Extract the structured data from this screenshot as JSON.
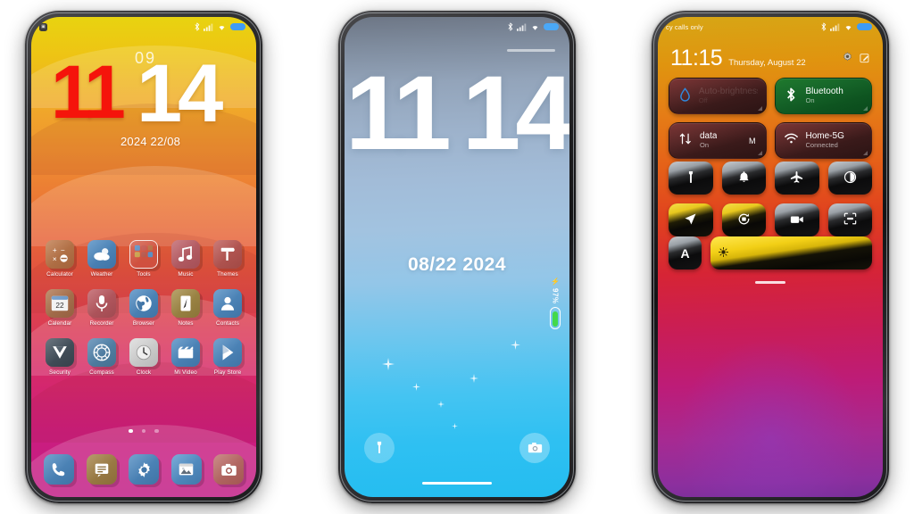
{
  "phone1": {
    "name": "home-screen",
    "statusbar": {
      "notification_badge": "app",
      "icons": [
        "bluetooth-icon",
        "signal-icon",
        "wifi-icon",
        "battery-icon"
      ]
    },
    "clock_widget": {
      "hours": "11",
      "minutes": "14",
      "seconds": "09",
      "date": "2024 22/08",
      "hours_color": "#f5140b",
      "minutes_color": "#ffffff"
    },
    "apps": [
      [
        {
          "label": "Calculator",
          "icon": "calculator-icon",
          "color": "#b5734a",
          "glyph": "÷"
        },
        {
          "label": "Weather",
          "icon": "weather-icon",
          "color": "#4a82b5",
          "glyph": "☁"
        },
        {
          "label": "Tools",
          "icon": "tools-folder-icon",
          "color": "#c0564f",
          "glyph": "••"
        },
        {
          "label": "Music",
          "icon": "music-icon",
          "color": "#b5565e",
          "glyph": "♫"
        },
        {
          "label": "Themes",
          "icon": "themes-icon",
          "color": "#b5504f",
          "glyph": "⛏"
        }
      ],
      [
        {
          "label": "Calendar",
          "icon": "calendar-icon",
          "color": "#a8714c",
          "glyph": "22"
        },
        {
          "label": "Recorder",
          "icon": "recorder-icon",
          "color": "#b5545a",
          "glyph": "Ἲ4"
        },
        {
          "label": "Browser",
          "icon": "browser-icon",
          "color": "#4a86bb",
          "glyph": "ἰd"
        },
        {
          "label": "Notes",
          "icon": "notes-icon",
          "color": "#9c8442",
          "glyph": "✎"
        },
        {
          "label": "Contacts",
          "icon": "contacts-icon",
          "color": "#4a86bb",
          "glyph": "὆4"
        }
      ],
      [
        {
          "label": "Security",
          "icon": "security-icon",
          "color": "#3f4b55",
          "glyph": "▼"
        },
        {
          "label": "Compass",
          "icon": "compass-icon",
          "color": "#4f7fa8",
          "glyph": "✲"
        },
        {
          "label": "Clock",
          "icon": "clock-icon",
          "color": "#c6c6c6",
          "glyph": "ὕ1"
        },
        {
          "label": "Mi Video",
          "icon": "mi-video-icon",
          "color": "#4a86bb",
          "glyph": "Ἲc"
        },
        {
          "label": "Play Store",
          "icon": "play-store-icon",
          "color": "#4a86bb",
          "glyph": "▶"
        }
      ]
    ],
    "page_dots": {
      "count": 3,
      "active_index": 0
    },
    "dock": [
      {
        "label": "Phone",
        "icon": "phone-icon",
        "color": "#4a86bb",
        "glyph": "Ὅe"
      },
      {
        "label": "Messages",
        "icon": "messages-icon",
        "color": "#9c7a47",
        "glyph": "Ὂc"
      },
      {
        "label": "Settings",
        "icon": "settings-icon",
        "color": "#4a86bb",
        "glyph": "⚙"
      },
      {
        "label": "Gallery",
        "icon": "gallery-icon",
        "color": "#4f8ec4",
        "glyph": "Ὓc"
      },
      {
        "label": "Camera",
        "icon": "camera-icon",
        "color": "#b5645e",
        "glyph": "὏7"
      }
    ]
  },
  "phone2": {
    "name": "lock-screen",
    "statusbar": {
      "icons": [
        "bluetooth-icon",
        "signal-icon",
        "wifi-icon",
        "battery-icon"
      ]
    },
    "clock": {
      "hours": "11",
      "minutes": "14",
      "date": "08/22 2024"
    },
    "battery": {
      "percent": "97%",
      "charging": true,
      "charging_glyph": "⚡"
    },
    "shortcuts": {
      "left": {
        "label": "Flashlight",
        "icon": "flashlight-icon"
      },
      "right": {
        "label": "Camera",
        "icon": "camera-icon"
      }
    }
  },
  "phone3": {
    "name": "control-center",
    "statusbar": {
      "carrier": "cy calls only",
      "icons": [
        "bluetooth-icon",
        "signal-icon",
        "wifi-icon",
        "battery-icon"
      ]
    },
    "header": {
      "time": "11:15",
      "date": "Thursday, August 22",
      "settings_icon": "gear-icon",
      "edit_icon": "edit-icon"
    },
    "big_tiles": [
      {
        "title": "Auto-brightness",
        "subtitle": "Off",
        "icon": "water-drop-icon",
        "state": "off",
        "dim": true
      },
      {
        "title": "Bluetooth",
        "subtitle": "On",
        "icon": "bluetooth-icon",
        "state": "on",
        "dim": false
      },
      {
        "title": "data",
        "subtitle": "On",
        "extra": "M",
        "icon": "mobile-data-icon",
        "state": "off",
        "dim": false
      },
      {
        "title": "Home-5G",
        "subtitle": "Connected",
        "icon": "wifi-icon",
        "state": "off",
        "dim": false
      }
    ],
    "quick_tiles": [
      {
        "label": "Flashlight",
        "icon": "flashlight-icon",
        "glyph": "ὒ6",
        "active": false
      },
      {
        "label": "Ring",
        "icon": "bell-icon",
        "glyph": "ὑ4",
        "active": false
      },
      {
        "label": "Airplane mode",
        "icon": "airplane-icon",
        "glyph": "✈",
        "active": false
      },
      {
        "label": "Dark mode",
        "icon": "dark-mode-icon",
        "glyph": "◐",
        "active": false
      },
      {
        "label": "Location",
        "icon": "location-icon",
        "glyph": "➤",
        "active": true
      },
      {
        "label": "Auto-rotate",
        "icon": "auto-rotate-icon",
        "glyph": "↻",
        "active": true
      },
      {
        "label": "Screen recorder",
        "icon": "video-camera-icon",
        "glyph": "὏9",
        "active": false
      },
      {
        "label": "Screenshot",
        "icon": "screenshot-icon",
        "glyph": "⬚",
        "active": false
      }
    ],
    "auto_brightness_button": {
      "label": "A",
      "icon": "auto-brightness-icon"
    },
    "brightness_slider": {
      "icon": "brightness-icon",
      "value": 88,
      "max": 100
    },
    "drag_handle": "control-center-handle"
  }
}
